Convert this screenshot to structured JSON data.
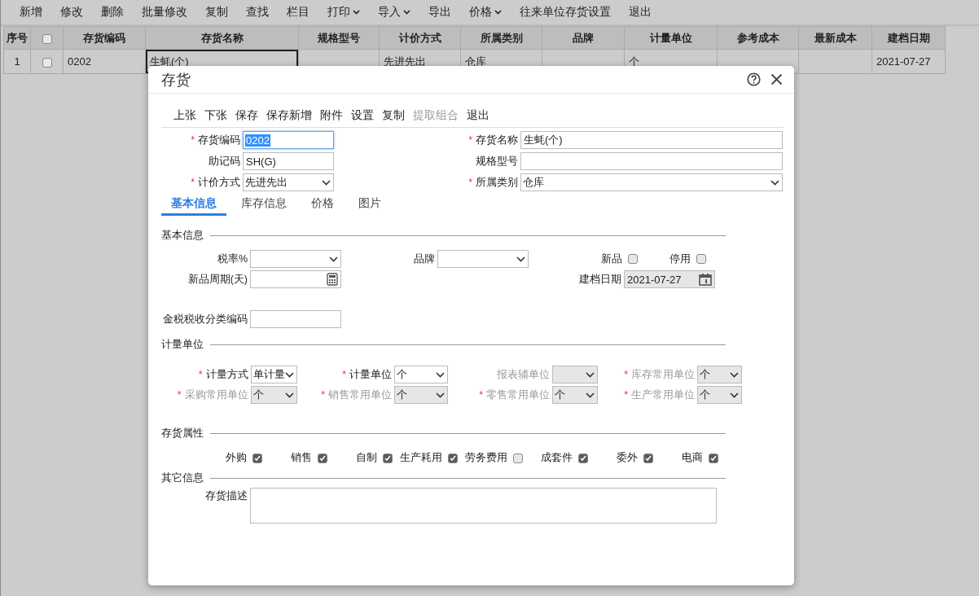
{
  "toolbar": [
    {
      "label": "新增",
      "has_menu": false
    },
    {
      "label": "修改",
      "has_menu": false
    },
    {
      "label": "删除",
      "has_menu": false
    },
    {
      "label": "批量修改",
      "has_menu": false
    },
    {
      "label": "复制",
      "has_menu": false
    },
    {
      "label": "查找",
      "has_menu": false
    },
    {
      "label": "栏目",
      "has_menu": false
    },
    {
      "label": "打印",
      "has_menu": true
    },
    {
      "label": "导入",
      "has_menu": true
    },
    {
      "label": "导出",
      "has_menu": false
    },
    {
      "label": "价格",
      "has_menu": true
    },
    {
      "label": "往来单位存货设置",
      "has_menu": false
    },
    {
      "label": "退出",
      "has_menu": false
    }
  ],
  "table": {
    "header_checked": false,
    "columns": [
      "序号",
      "",
      "存货编码",
      "存货名称",
      "规格型号",
      "计价方式",
      "所属类别",
      "品牌",
      "计量单位",
      "参考成本",
      "最新成本",
      "建档日期"
    ],
    "rows": [
      {
        "checked": false,
        "cells": [
          {
            "text": "1",
            "editing": false
          },
          {
            "editing": false
          },
          {
            "text": "0202",
            "editing": false
          },
          {
            "text": "生蚝(个)",
            "editing": true
          },
          {
            "editing": false
          },
          {
            "text": "先进先出",
            "editing": false
          },
          {
            "text": "仓库",
            "editing": false
          },
          {
            "editing": false
          },
          {
            "text": "个",
            "editing": false
          },
          {
            "editing": false
          },
          {
            "editing": false
          },
          {
            "text": "2021-07-27",
            "editing": false
          }
        ]
      }
    ]
  },
  "dialog": {
    "title": "存货",
    "toolbar": [
      {
        "label": "上张",
        "disabled": false
      },
      {
        "label": "下张",
        "disabled": false
      },
      {
        "label": "保存",
        "disabled": false
      },
      {
        "label": "保存新增",
        "disabled": false
      },
      {
        "label": "附件",
        "disabled": false
      },
      {
        "label": "设置",
        "disabled": false
      },
      {
        "label": "复制",
        "disabled": false
      },
      {
        "label": "提取组合",
        "disabled": true
      },
      {
        "label": "退出",
        "disabled": false
      }
    ],
    "header_fields": [
      {
        "label": "存货编码",
        "required_mark": "*",
        "kind": "input",
        "value": "0202",
        "selected": true
      },
      {
        "label": "存货名称",
        "required_mark": "*",
        "kind": "input",
        "value": "生蚝(个)",
        "selected": false
      },
      {
        "label": "助记码",
        "kind": "input",
        "value": "SH(G)",
        "selected": false
      },
      {
        "label": "规格型号",
        "kind": "input",
        "selected": false
      },
      {
        "label": "计价方式",
        "required_mark": "*",
        "kind": "select",
        "value": "先进先出",
        "selected": false
      },
      {
        "label": "所属类别",
        "required_mark": "*",
        "kind": "select",
        "value": "仓库",
        "selected": false
      }
    ],
    "tabs": [
      {
        "label": "基本信息",
        "selected": true
      },
      {
        "label": "库存信息",
        "selected": false
      },
      {
        "label": "价格",
        "selected": false
      },
      {
        "label": "图片",
        "selected": false
      }
    ],
    "basic_info": {
      "title": "基本信息",
      "rows": [
        {
          "left": {
            "label": "税率%",
            "kind": "select"
          },
          "middle": {
            "label": "品牌",
            "kind": "select"
          },
          "right": [
            {
              "label": "新品",
              "kind": "checkbox",
              "checked": false
            },
            {
              "label": "停用",
              "kind": "checkbox",
              "checked": false
            }
          ]
        },
        {
          "left": {
            "label": "新品周期(天)",
            "kind": "calc"
          },
          "right": [
            {
              "label": "建档日期",
              "kind": "date",
              "value": "2021-07-27"
            }
          ]
        },
        {
          "left": {
            "label": "金税税收分类编码",
            "kind": "input"
          }
        }
      ]
    },
    "units": {
      "title": "计量单位",
      "fields": [
        {
          "label": "计量方式",
          "required_mark": "*",
          "value": "单计量",
          "disabled": false
        },
        {
          "label": "计量单位",
          "required_mark": "*",
          "value": "个",
          "disabled": false
        },
        {
          "label": "报表辅单位",
          "disabled": true
        },
        {
          "label": "库存常用单位",
          "required_mark": "*",
          "value": "个",
          "disabled": true
        },
        {
          "label": "采购常用单位",
          "required_mark": "*",
          "value": "个",
          "disabled": true
        },
        {
          "label": "销售常用单位",
          "required_mark": "*",
          "value": "个",
          "disabled": true
        },
        {
          "label": "零售常用单位",
          "required_mark": "*",
          "value": "个",
          "disabled": true
        },
        {
          "label": "生产常用单位",
          "required_mark": "*",
          "value": "个",
          "disabled": true
        }
      ]
    },
    "attributes": {
      "title": "存货属性",
      "items": [
        {
          "label": "外购",
          "checked": true
        },
        {
          "label": "销售",
          "checked": true
        },
        {
          "label": "自制",
          "checked": true
        },
        {
          "label": "生产耗用",
          "checked": true
        },
        {
          "label": "劳务费用",
          "checked": false
        },
        {
          "label": "成套件",
          "checked": true
        },
        {
          "label": "委外",
          "checked": true
        },
        {
          "label": "电商",
          "checked": true
        }
      ]
    },
    "other_info": {
      "title": "其它信息",
      "description_label": "存货描述"
    }
  }
}
